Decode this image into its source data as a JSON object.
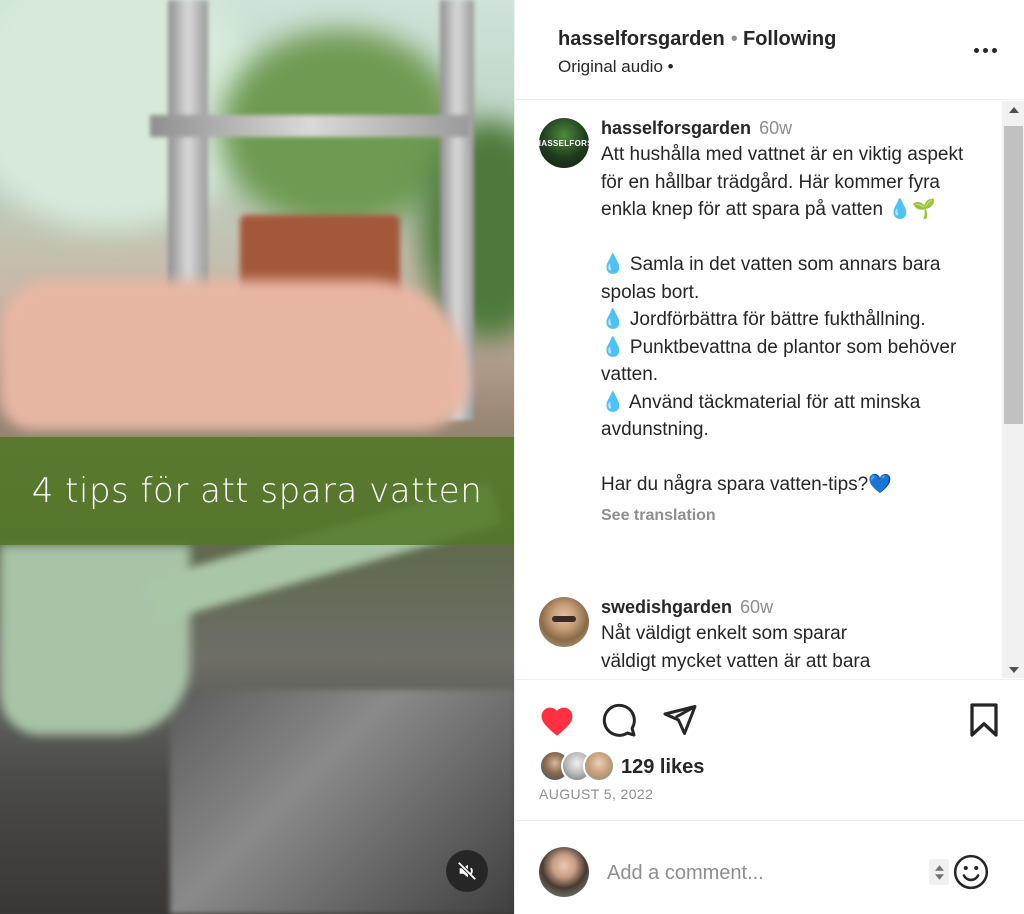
{
  "media": {
    "overlay_text": "4 tips för att spara vatten",
    "mute_icon": "speaker-muted-icon"
  },
  "header": {
    "username": "hasselforsgarden",
    "separator": "•",
    "follow_status": "Following",
    "audio": "Original audio •",
    "more_icon": "more-horizontal-icon"
  },
  "caption": {
    "username": "hasselforsgarden",
    "time": "60w",
    "avatar_text": "HASSELFORS",
    "text": "Att hushålla med vattnet är en viktig aspekt för en hållbar trädgård. Här kommer fyra enkla knep för att spara på vatten 💧🌱\n\n💧 Samla in det vatten som annars bara spolas bort.\n💧 Jordförbättra för bättre fukthållning.\n💧 Punktbevattna de plantor som behöver vatten.\n💧 Använd täckmaterial för att minska avdunstning.\n\nHar du några spara vatten-tips?💙",
    "see_translation": "See translation"
  },
  "comments": [
    {
      "username": "swedishgarden",
      "time": "60w",
      "text": "Nåt väldigt enkelt som sparar\nväldigt mycket vatten är att bara"
    }
  ],
  "actions": {
    "like_icon": "heart-filled-icon",
    "comment_icon": "comment-icon",
    "share_icon": "send-icon",
    "save_icon": "bookmark-icon",
    "like_color": "#ff3040"
  },
  "likes": "129 likes",
  "date": "AUGUST 5, 2022",
  "composer": {
    "placeholder": "Add a comment...",
    "emoji_icon": "smiley-icon"
  }
}
